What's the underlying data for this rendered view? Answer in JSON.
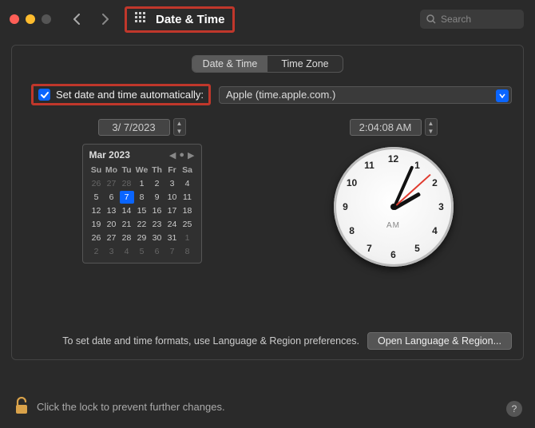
{
  "header": {
    "title": "Date & Time",
    "search_placeholder": "Search"
  },
  "tabs": {
    "date_time": "Date & Time",
    "time_zone": "Time Zone"
  },
  "auto": {
    "label": "Set date and time automatically:",
    "server": "Apple (time.apple.com.)"
  },
  "date_field": "3/ 7/2023",
  "time_field": "2:04:08 AM",
  "calendar": {
    "title": "Mar 2023",
    "dow": [
      "Su",
      "Mo",
      "Tu",
      "We",
      "Th",
      "Fr",
      "Sa"
    ],
    "leading_dim": [
      "26",
      "27",
      "28"
    ],
    "days": [
      "1",
      "2",
      "3",
      "4",
      "5",
      "6",
      "7",
      "8",
      "9",
      "10",
      "11",
      "12",
      "13",
      "14",
      "15",
      "16",
      "17",
      "18",
      "19",
      "20",
      "21",
      "22",
      "23",
      "24",
      "25",
      "26",
      "27",
      "28",
      "29",
      "30",
      "31"
    ],
    "trailing_dim": [
      "1",
      "2",
      "3",
      "4",
      "5",
      "6",
      "7",
      "8"
    ],
    "selected": "7"
  },
  "clock": {
    "ampm": "AM",
    "hour_angle": -30,
    "min_angle": -66,
    "sec_angle": -42
  },
  "panel_footer": {
    "text": "To set date and time formats, use Language & Region preferences.",
    "button": "Open Language & Region..."
  },
  "lock": {
    "text": "Click the lock to prevent further changes."
  },
  "help": "?"
}
